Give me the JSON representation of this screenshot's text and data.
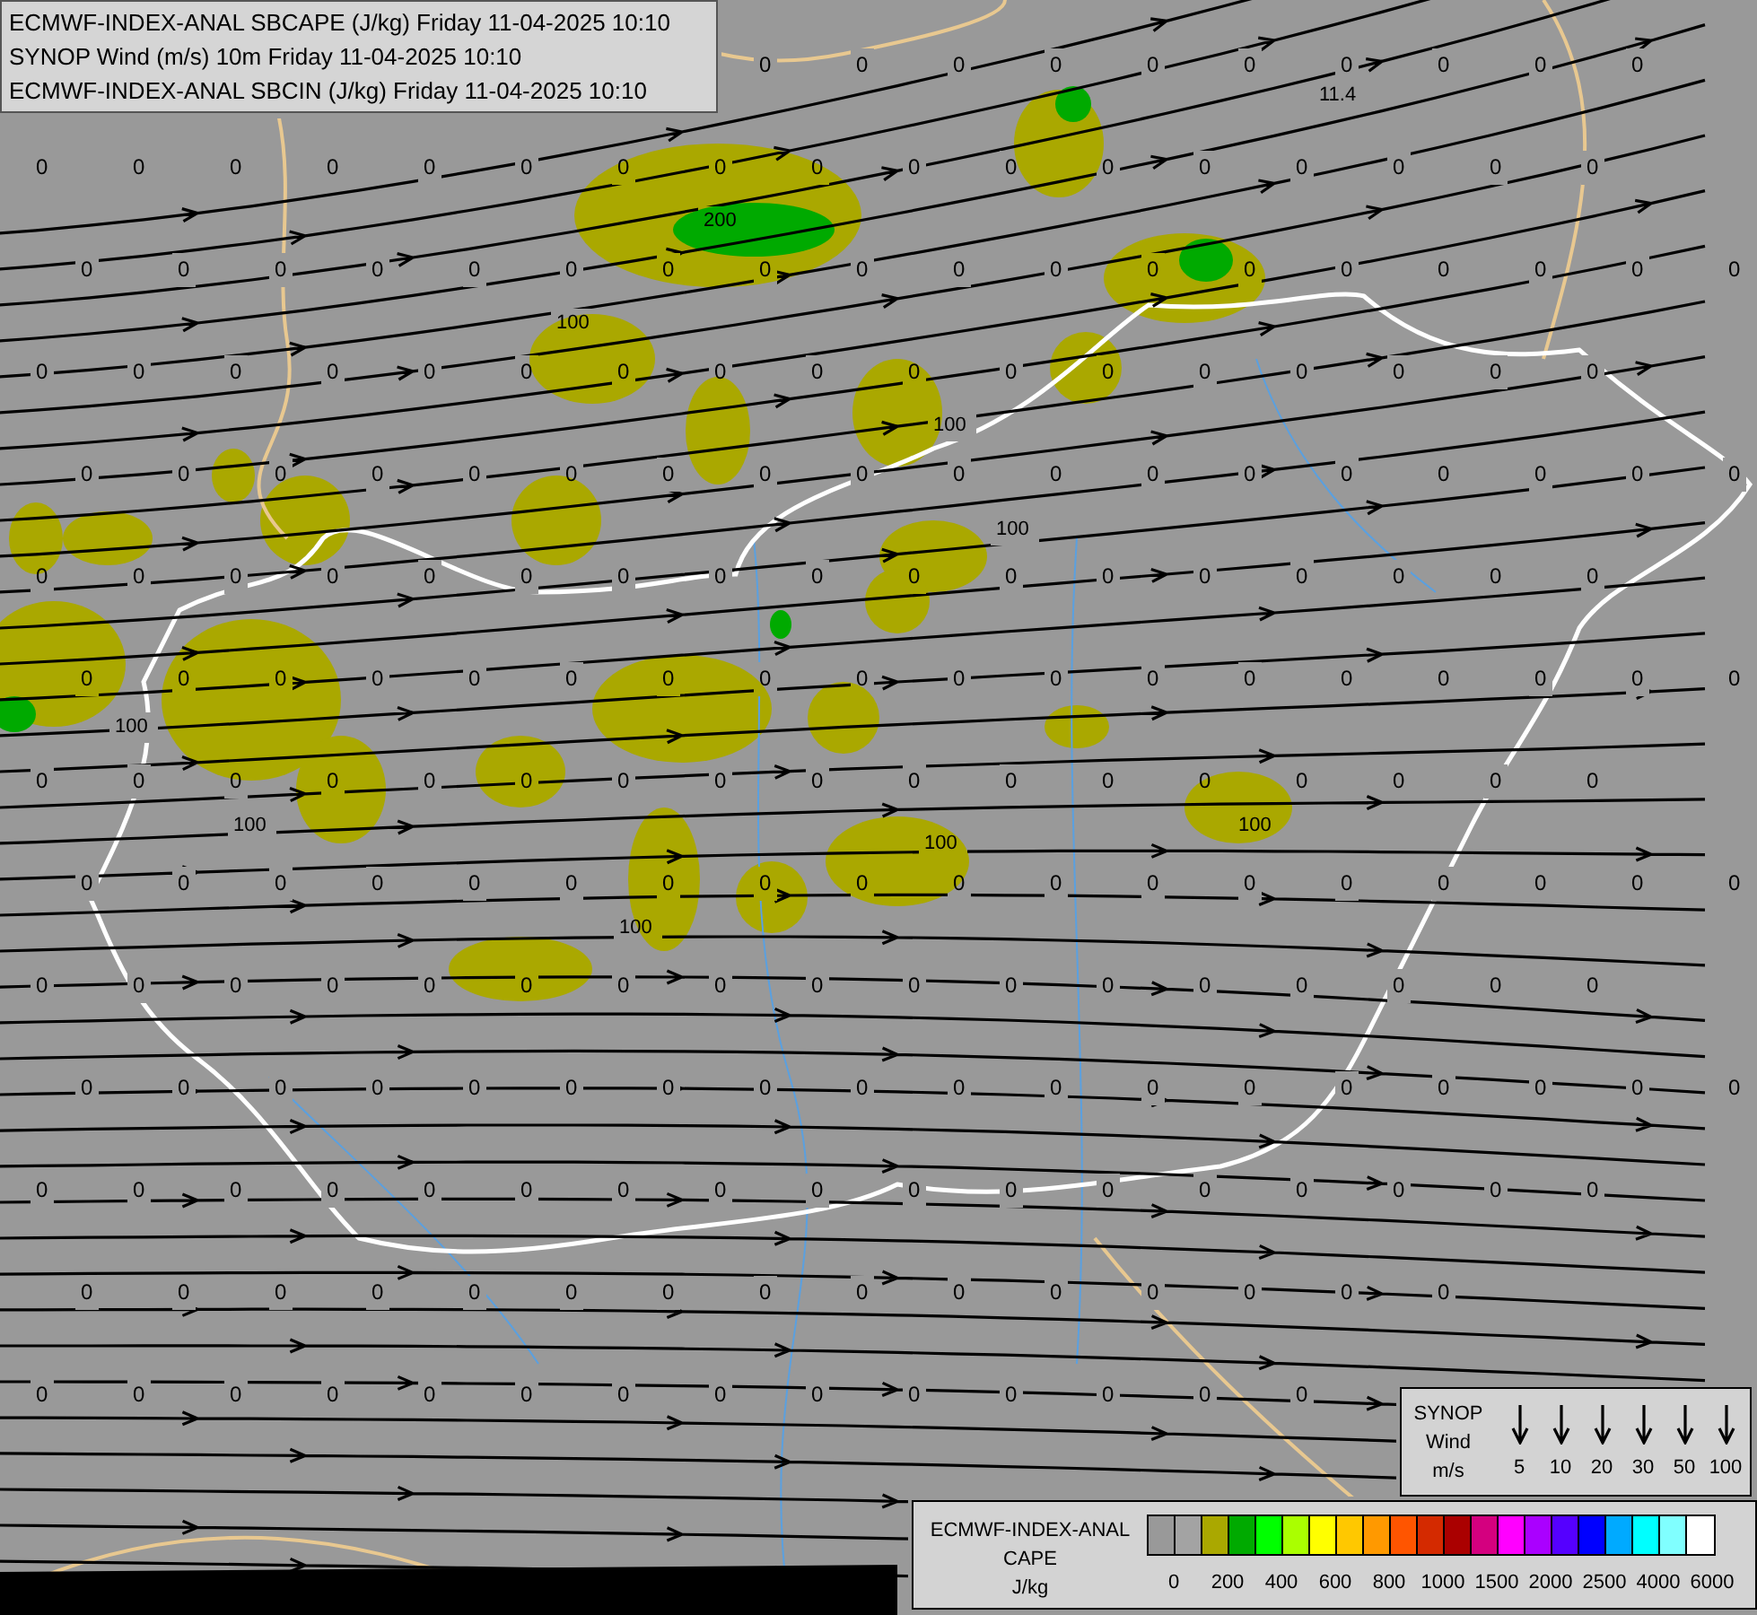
{
  "header": {
    "lines": [
      "ECMWF-INDEX-ANAL SBCAPE (J/kg) Friday 11-04-2025 10:10",
      "SYNOP Wind (m/s) 10m Friday 11-04-2025 10:10",
      "ECMWF-INDEX-ANAL SBCIN (J/kg) Friday 11-04-2025 10:10"
    ]
  },
  "map": {
    "grid_rows": [
      {
        "labels": [
          "0",
          "0",
          "0",
          "0",
          "0",
          "0",
          "0",
          "0",
          "0",
          "0"
        ]
      },
      {
        "labels": [
          "0",
          "0",
          "0",
          "0",
          "0",
          "0",
          "0",
          "0",
          "0",
          "0",
          "0",
          "0",
          "0",
          "0",
          "0",
          "0",
          "0"
        ]
      },
      {
        "labels": [
          "0",
          "0",
          "0",
          "0",
          "0",
          "0",
          "0",
          "0",
          "0",
          "0",
          "0",
          "0",
          "0",
          "0",
          "0",
          "0",
          "0",
          "0"
        ]
      },
      {
        "labels": [
          "0",
          "0",
          "0",
          "0",
          "0",
          "0",
          "0",
          "0",
          "0",
          "0",
          "0",
          "0",
          "0",
          "0",
          "0",
          "0",
          "0"
        ]
      },
      {
        "labels": [
          "0",
          "0",
          "0",
          "0",
          "0",
          "0",
          "0",
          "0",
          "0",
          "0",
          "0",
          "0",
          "0",
          "0",
          "0",
          "0",
          "0",
          "0"
        ]
      },
      {
        "labels": [
          "0",
          "0",
          "0",
          "0",
          "0",
          "0",
          "0",
          "0",
          "0",
          "0",
          "0",
          "0",
          "0",
          "0",
          "0",
          "0",
          "0"
        ]
      },
      {
        "labels": [
          "0",
          "0",
          "0",
          "0",
          "0",
          "0",
          "0",
          "0",
          "0",
          "0",
          "0",
          "0",
          "0",
          "0",
          "0",
          "0",
          "0",
          "0"
        ]
      },
      {
        "labels": [
          "0",
          "0",
          "0",
          "0",
          "0",
          "0",
          "0",
          "0",
          "0",
          "0",
          "0",
          "0",
          "0",
          "0",
          "0",
          "0",
          "0"
        ]
      },
      {
        "labels": [
          "0",
          "0",
          "0",
          "0",
          "0",
          "0",
          "0",
          "0",
          "0",
          "0",
          "0",
          "0",
          "0",
          "0",
          "0",
          "0",
          "0",
          "0"
        ]
      },
      {
        "labels": [
          "0",
          "0",
          "0",
          "0",
          "0",
          "0",
          "0",
          "0",
          "0",
          "0",
          "0",
          "0",
          "0",
          "0",
          "0",
          "0",
          "0"
        ]
      },
      {
        "labels": [
          "0",
          "0",
          "0",
          "0",
          "0",
          "0",
          "0",
          "0",
          "0",
          "0",
          "0",
          "0",
          "0",
          "0",
          "0",
          "0",
          "0",
          "0"
        ]
      },
      {
        "labels": [
          "0",
          "0",
          "0",
          "0",
          "0",
          "0",
          "0",
          "0",
          "0",
          "0",
          "0",
          "0",
          "0",
          "0",
          "0",
          "0",
          "0"
        ]
      },
      {
        "labels": [
          "0",
          "0",
          "0",
          "0",
          "0",
          "0",
          "0",
          "0",
          "0",
          "0",
          "0",
          "0",
          "0",
          "0",
          "0"
        ]
      },
      {
        "labels": [
          "0",
          "0",
          "0",
          "0",
          "0",
          "0",
          "0",
          "0",
          "0",
          "0",
          "0",
          "0",
          "0",
          "0"
        ]
      }
    ],
    "contour_labels": [
      "200",
      "100",
      "100",
      "100",
      "100",
      "100",
      "100",
      "100",
      "100",
      "11.4"
    ]
  },
  "wind_legend": {
    "title_lines": [
      "SYNOP",
      "Wind",
      "m/s"
    ],
    "speeds": [
      "5",
      "10",
      "20",
      "30",
      "50",
      "100"
    ]
  },
  "cape_legend": {
    "title_lines": [
      "ECMWF-INDEX-ANAL",
      "CAPE",
      "J/kg"
    ],
    "colors": [
      {
        "color": "#999999"
      },
      {
        "color": "#a3a3a3"
      },
      {
        "color": "#aaa800"
      },
      {
        "color": "#00aa00"
      },
      {
        "color": "#00ff00"
      },
      {
        "color": "#aaff00"
      },
      {
        "color": "#ffff00"
      },
      {
        "color": "#ffc800"
      },
      {
        "color": "#ff9900"
      },
      {
        "color": "#ff5500"
      },
      {
        "color": "#d42a00"
      },
      {
        "color": "#aa0000"
      },
      {
        "color": "#d4007f"
      },
      {
        "color": "#ff00ff"
      },
      {
        "color": "#aa00ff"
      },
      {
        "color": "#5500ff"
      },
      {
        "color": "#0000ff"
      },
      {
        "color": "#00aaff"
      },
      {
        "color": "#00ffff"
      },
      {
        "color": "#80ffff"
      },
      {
        "color": "#ffffff"
      }
    ],
    "ticks": [
      "0",
      "200",
      "400",
      "600",
      "800",
      "1000",
      "1500",
      "2000",
      "2500",
      "4000",
      "6000"
    ]
  }
}
